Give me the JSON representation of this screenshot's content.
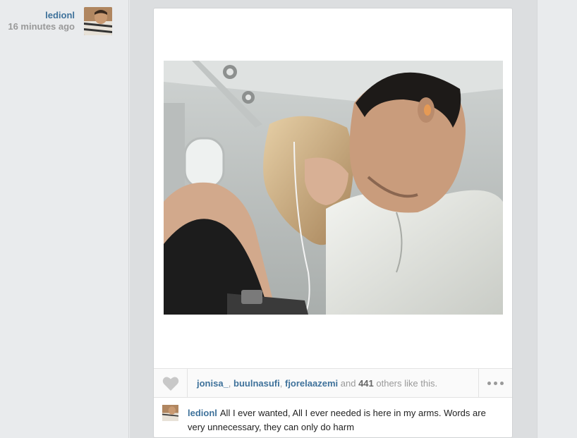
{
  "post": {
    "author": "ledionl",
    "time_ago": "16 minutes ago",
    "likes": {
      "users": [
        "jonisa_",
        "buulnasufi",
        "fjorelaazemi"
      ],
      "sep": ", ",
      "and_text": " and ",
      "count": "441",
      "suffix": " others like this."
    },
    "caption": {
      "user": "ledionl",
      "text": "All I ever wanted, All I ever needed is here in my arms. Words are very unnecessary, they can only do harm"
    }
  },
  "icons": {
    "like": "heart-icon",
    "more": "more-dots-icon",
    "avatar": "avatar-image"
  },
  "colors": {
    "username": "#3f729b",
    "muted": "#999999",
    "page_bg": "#e9ebed"
  }
}
